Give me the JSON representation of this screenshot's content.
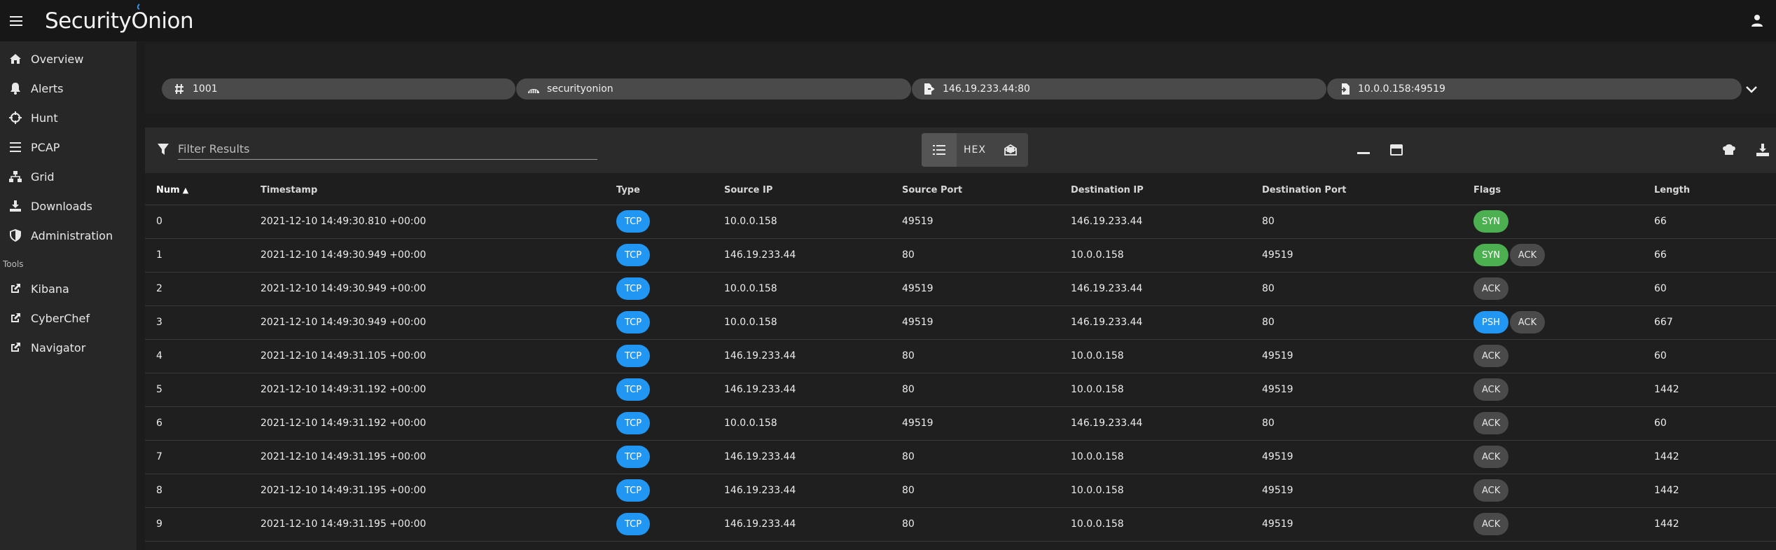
{
  "app": {
    "logo_text_pre": "Security",
    "logo_text_o": "O",
    "logo_text_post": "nion"
  },
  "sidebar": {
    "items": [
      {
        "label": "Overview",
        "icon": "home-icon"
      },
      {
        "label": "Alerts",
        "icon": "bell-icon"
      },
      {
        "label": "Hunt",
        "icon": "crosshairs-icon"
      },
      {
        "label": "PCAP",
        "icon": "list-icon"
      },
      {
        "label": "Grid",
        "icon": "network-icon"
      },
      {
        "label": "Downloads",
        "icon": "download-icon"
      },
      {
        "label": "Administration",
        "icon": "shield-icon"
      }
    ],
    "tools_heading": "Tools",
    "tools": [
      {
        "label": "Kibana",
        "icon": "external-link-icon"
      },
      {
        "label": "CyberChef",
        "icon": "external-link-icon"
      },
      {
        "label": "Navigator",
        "icon": "external-link-icon"
      }
    ]
  },
  "chips": [
    {
      "label": "1001",
      "icon": "hash-icon"
    },
    {
      "label": "securityonion",
      "icon": "sensor-icon"
    },
    {
      "label": "146.19.233.44:80",
      "icon": "file-export-icon"
    },
    {
      "label": "10.0.0.158:49519",
      "icon": "file-import-icon"
    }
  ],
  "toolbar": {
    "filter_placeholder": "Filter Results",
    "hex_label": "HEX"
  },
  "table": {
    "columns": [
      "Num",
      "Timestamp",
      "Type",
      "Source IP",
      "Source Port",
      "Destination IP",
      "Destination Port",
      "Flags",
      "Length"
    ],
    "sort_indicator": "▲",
    "rows": [
      {
        "num": "0",
        "ts": "2021-12-10 14:49:30.810 +00:00",
        "type": "TCP",
        "src": "10.0.0.158",
        "sport": "49519",
        "dst": "146.19.233.44",
        "dport": "80",
        "flags": [
          "SYN"
        ],
        "len": "66"
      },
      {
        "num": "1",
        "ts": "2021-12-10 14:49:30.949 +00:00",
        "type": "TCP",
        "src": "146.19.233.44",
        "sport": "80",
        "dst": "10.0.0.158",
        "dport": "49519",
        "flags": [
          "SYN",
          "ACK"
        ],
        "len": "66"
      },
      {
        "num": "2",
        "ts": "2021-12-10 14:49:30.949 +00:00",
        "type": "TCP",
        "src": "10.0.0.158",
        "sport": "49519",
        "dst": "146.19.233.44",
        "dport": "80",
        "flags": [
          "ACK"
        ],
        "len": "60"
      },
      {
        "num": "3",
        "ts": "2021-12-10 14:49:30.949 +00:00",
        "type": "TCP",
        "src": "10.0.0.158",
        "sport": "49519",
        "dst": "146.19.233.44",
        "dport": "80",
        "flags": [
          "PSH",
          "ACK"
        ],
        "len": "667"
      },
      {
        "num": "4",
        "ts": "2021-12-10 14:49:31.105 +00:00",
        "type": "TCP",
        "src": "146.19.233.44",
        "sport": "80",
        "dst": "10.0.0.158",
        "dport": "49519",
        "flags": [
          "ACK"
        ],
        "len": "60"
      },
      {
        "num": "5",
        "ts": "2021-12-10 14:49:31.192 +00:00",
        "type": "TCP",
        "src": "146.19.233.44",
        "sport": "80",
        "dst": "10.0.0.158",
        "dport": "49519",
        "flags": [
          "ACK"
        ],
        "len": "1442"
      },
      {
        "num": "6",
        "ts": "2021-12-10 14:49:31.192 +00:00",
        "type": "TCP",
        "src": "10.0.0.158",
        "sport": "49519",
        "dst": "146.19.233.44",
        "dport": "80",
        "flags": [
          "ACK"
        ],
        "len": "60"
      },
      {
        "num": "7",
        "ts": "2021-12-10 14:49:31.195 +00:00",
        "type": "TCP",
        "src": "146.19.233.44",
        "sport": "80",
        "dst": "10.0.0.158",
        "dport": "49519",
        "flags": [
          "ACK"
        ],
        "len": "1442"
      },
      {
        "num": "8",
        "ts": "2021-12-10 14:49:31.195 +00:00",
        "type": "TCP",
        "src": "146.19.233.44",
        "sport": "80",
        "dst": "10.0.0.158",
        "dport": "49519",
        "flags": [
          "ACK"
        ],
        "len": "1442"
      },
      {
        "num": "9",
        "ts": "2021-12-10 14:49:31.195 +00:00",
        "type": "TCP",
        "src": "146.19.233.44",
        "sport": "80",
        "dst": "10.0.0.158",
        "dport": "49519",
        "flags": [
          "ACK"
        ],
        "len": "1442"
      }
    ]
  },
  "colors": {
    "tcp": "#2196f3",
    "syn": "#4caf50",
    "psh": "#2196f3",
    "ack": "#4a4a4a",
    "logo_accent": "#3d8fd9"
  }
}
